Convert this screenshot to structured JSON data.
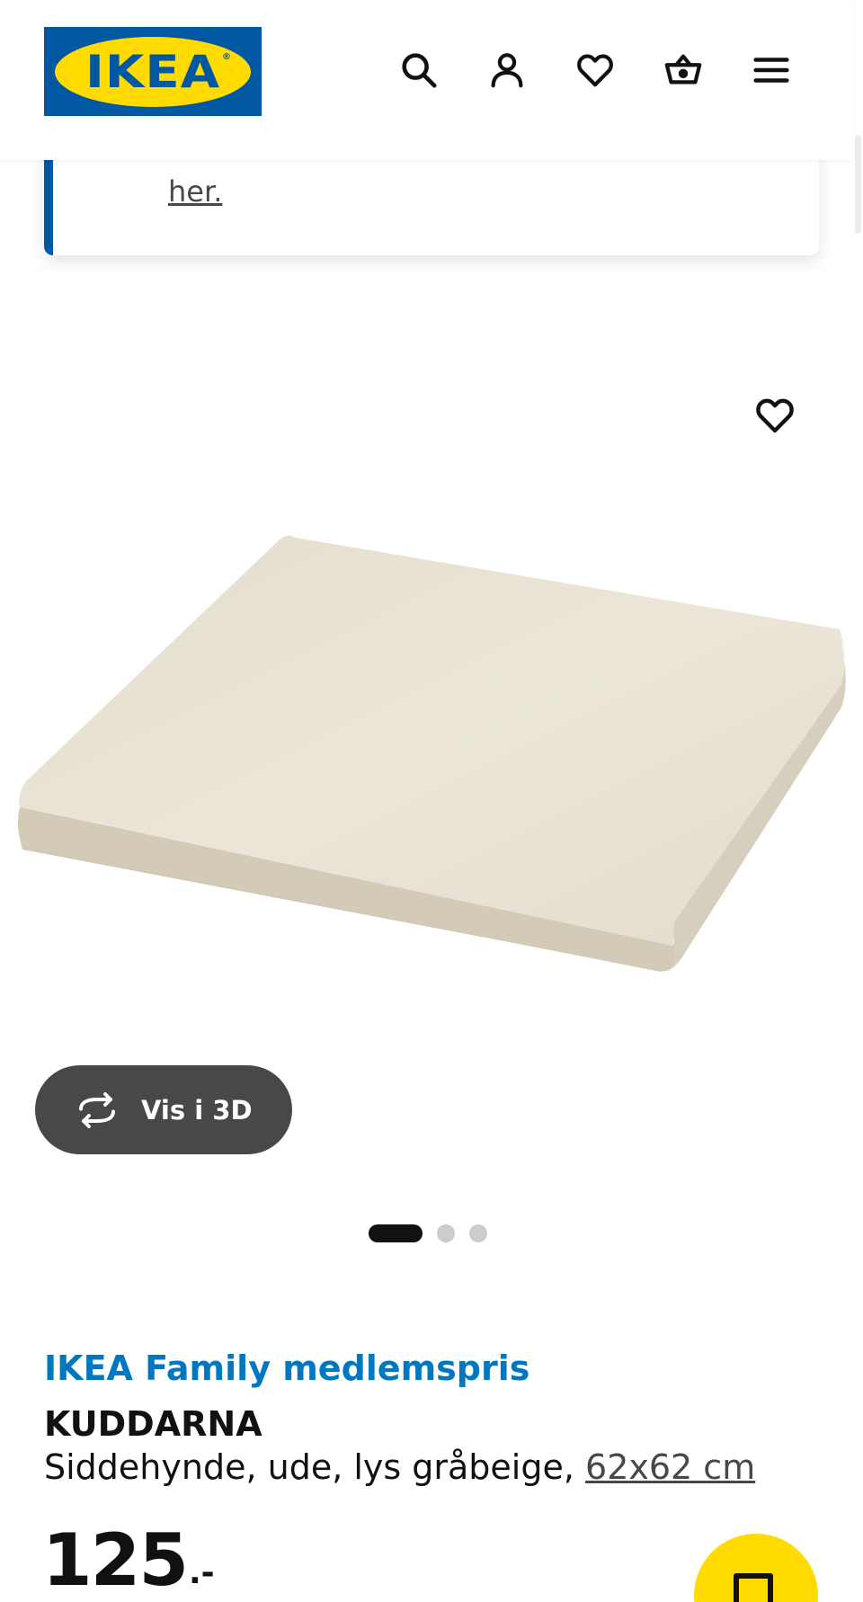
{
  "header": {
    "logo_text": "IKEA",
    "logo_mark": "®",
    "icons": [
      "search-icon",
      "user-icon",
      "heart-icon",
      "cart-icon",
      "menu-icon"
    ]
  },
  "notice": {
    "link_text": "her."
  },
  "gallery": {
    "view_3d_label": "Vis i 3D",
    "slide_count": 3,
    "active_slide": 1
  },
  "product": {
    "family_label": "IKEA Family medlemspris",
    "name": "KUDDARNA",
    "description": "Siddehynde, ude, lys gråbeige, ",
    "size": "62x62 cm",
    "price_integer": "125",
    "price_suffix": ".-"
  },
  "colors": {
    "brand_blue": "#0058a3",
    "brand_yellow": "#ffdb00",
    "family_blue": "#0077c1",
    "cushion": "#e6e0d2"
  }
}
